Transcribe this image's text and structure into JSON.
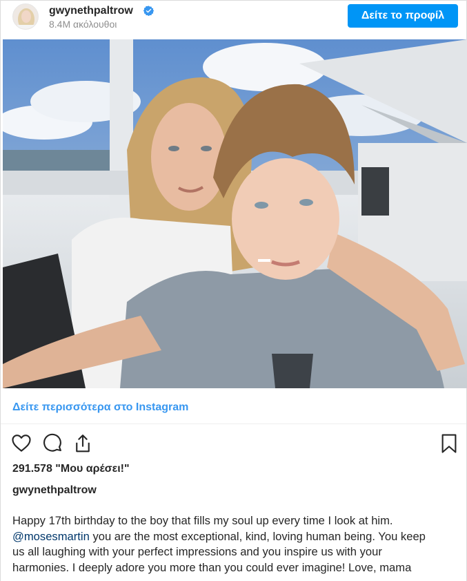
{
  "header": {
    "username": "gwynethpaltrow",
    "followers": "8.4M ακόλουθοι",
    "view_profile_label": "Δείτε το προφίλ"
  },
  "post": {
    "photo": {
      "verified_badge_color": "#3897f0",
      "icon": "photo"
    },
    "view_more_label": "Δείτε περισσότερα στο Instagram",
    "likes": "291.578 \"Μου αρέσει!\"",
    "owner_username": "gwynethpaltrow",
    "caption": {
      "line1": "Happy 17th birthday to the boy that fills my soul up every time I look at him.",
      "mention": "@mosesmartin",
      "line2_rest": " you are the most exceptional, kind, loving human being. You keep",
      "line3": "us all laughing with your perfect impressions and you inspire us with your",
      "line4": "harmonies. I deeply adore you more than you could ever imagine! Love, mama"
    }
  },
  "icons": [
    "verified-badge",
    "heart",
    "comment",
    "share",
    "bookmark"
  ],
  "colors": {
    "accent": "#0095f6",
    "link": "#3897f0",
    "mention": "#00376b"
  }
}
